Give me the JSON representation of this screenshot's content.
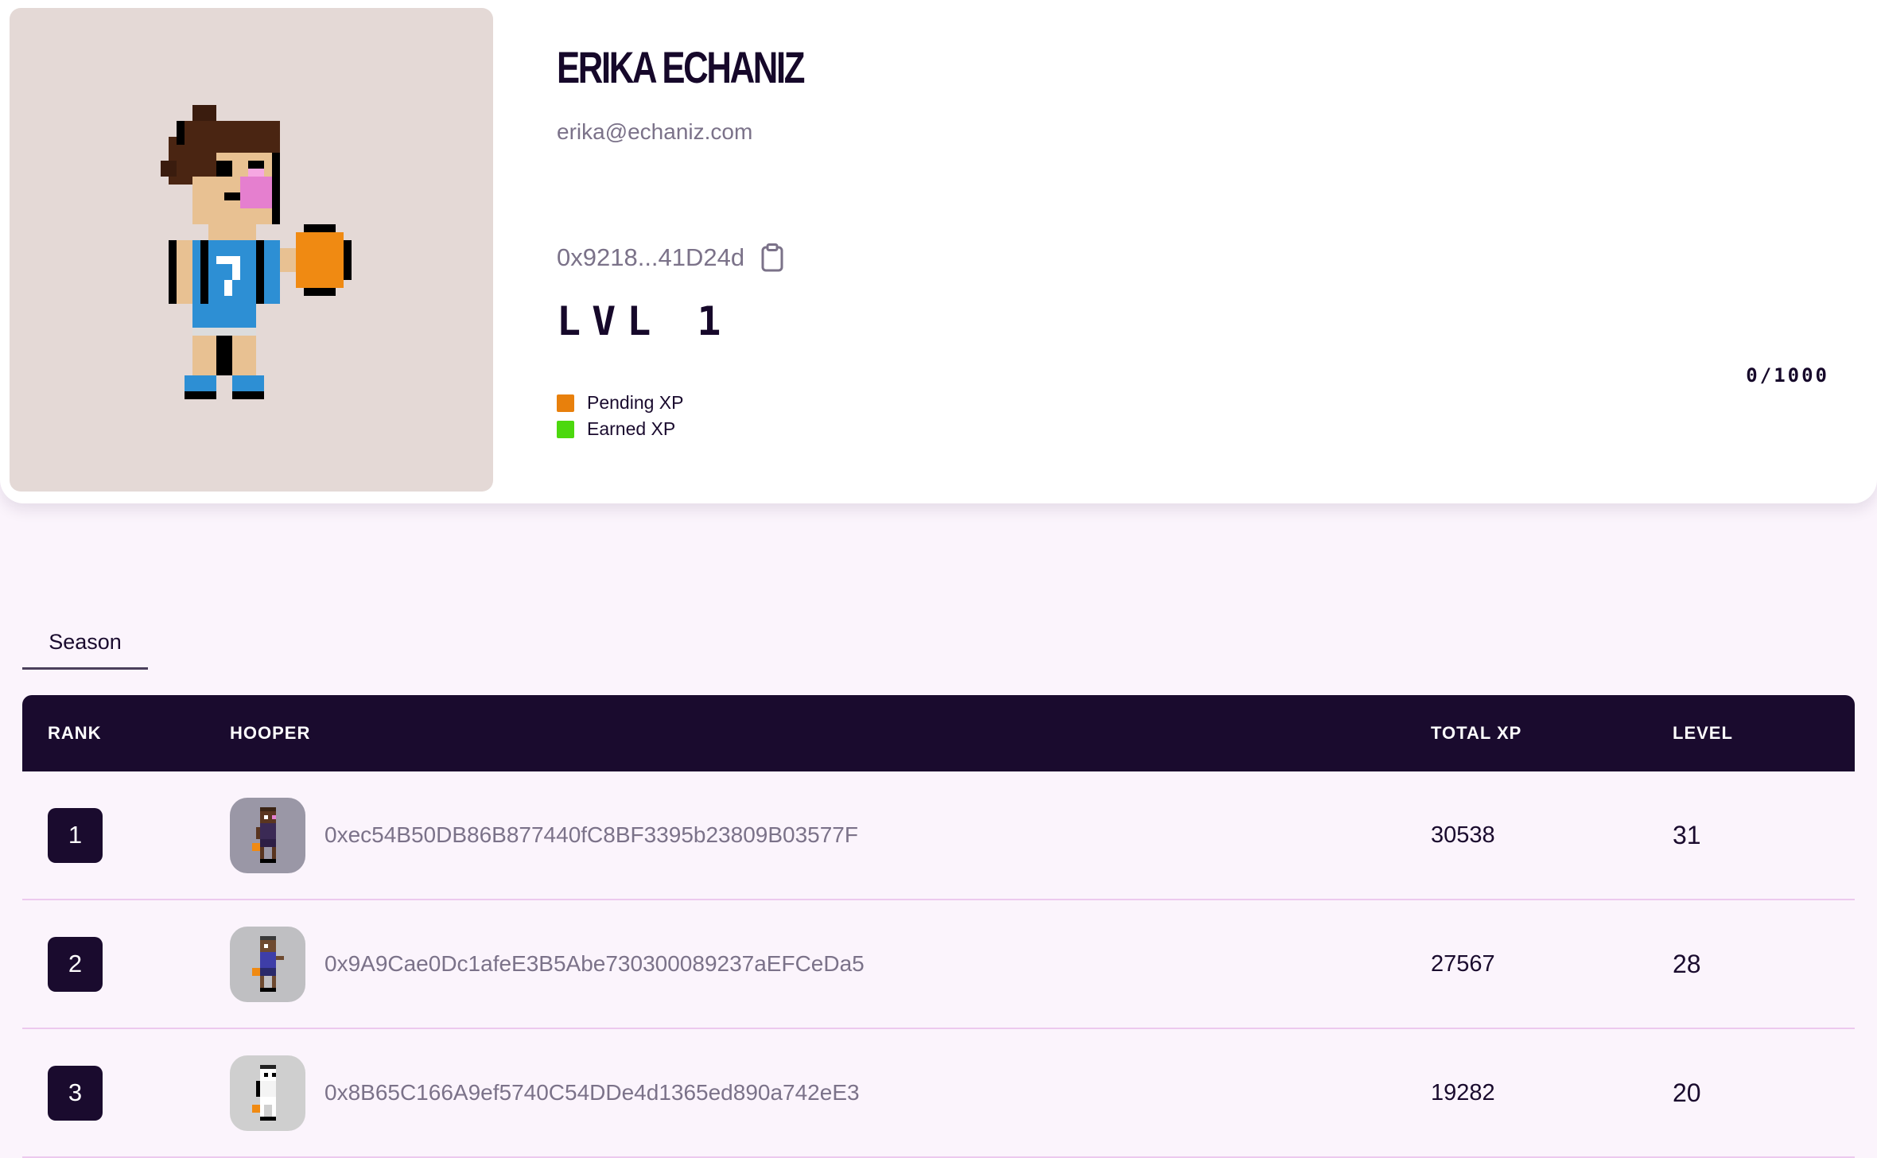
{
  "profile": {
    "name": "ERIKA ECHANIZ",
    "email": "erika@echaniz.com",
    "wallet": "0x9218...41D24d",
    "level": "LVL 1",
    "xp_progress": "0/1000",
    "jersey_number": "7",
    "legend": [
      {
        "label": "Pending XP",
        "color": "#e8800c"
      },
      {
        "label": "Earned XP",
        "color": "#4cd80e"
      }
    ]
  },
  "tabs": {
    "active": "Season"
  },
  "leaderboard": {
    "headers": {
      "rank": "RANK",
      "hooper": "HOOPER",
      "total_xp": "TOTAL XP",
      "level": "LEVEL"
    },
    "rows": [
      {
        "rank": "1",
        "address": "0xec54B50DB86B877440fC8BF3395b23809B03577F",
        "total_xp": "30538",
        "level": "31",
        "avatar_bg": "#9a97a6"
      },
      {
        "rank": "2",
        "address": "0x9A9Cae0Dc1afeE3B5Abe730300089237aEFCeDa5",
        "total_xp": "27567",
        "level": "28",
        "avatar_bg": "#bfbfc2"
      },
      {
        "rank": "3",
        "address": "0x8B65C166A9ef5740C54DDe4d1365ed890a742eE3",
        "total_xp": "19282",
        "level": "20",
        "avatar_bg": "#cfcfcf"
      }
    ]
  },
  "colors": {
    "dark": "#1a0b2e",
    "muted_text": "#7b7289",
    "page_bg": "#fbf4fc",
    "divider": "#ecc9ee"
  }
}
